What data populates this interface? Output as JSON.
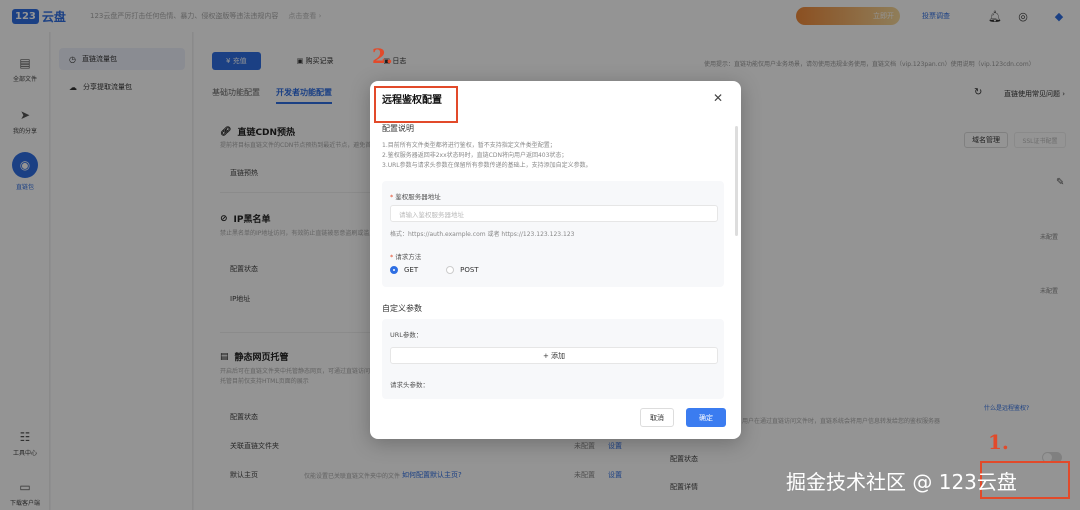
{
  "topbar": {
    "logo_badge": "123",
    "logo_text": "云盘",
    "notice": "123云盘严厉打击任何色情、暴力、侵权盗版等违法违规内容",
    "notice_more": "点击查看 ›",
    "promo_text": "",
    "promo_sub": "立即开",
    "link": "投票调查"
  },
  "rail": {
    "items": [
      {
        "label": "全部文件",
        "icon": "file-icon"
      },
      {
        "label": "我的分享",
        "icon": "share-icon"
      },
      {
        "label": "直链包",
        "icon": "link-icon"
      },
      {
        "label": "工具中心",
        "icon": "grid-icon"
      },
      {
        "label": "下载客户端",
        "icon": "monitor-icon"
      }
    ]
  },
  "sidenav": {
    "items": [
      {
        "label": "直链流量包"
      },
      {
        "label": "分享提取流量包"
      }
    ]
  },
  "main": {
    "tabs": [
      "充值",
      "购买记录",
      "日志"
    ],
    "subtabs": [
      "基础功能配置",
      "开发者功能配置"
    ],
    "right_notice": "使用提示：直链功能仅用户业务场景，请勿使用违规业务使用，直链文档（vip.123pan.cn）使用说明（vip.123cdn.com）",
    "help_link": "直链使用常见问题 ›",
    "cdn": {
      "title": "直链CDN预热",
      "desc": "提前将目标直链文件的CDN节点预热到最近节点，避免首次访问速度慢",
      "row_label": "直链预热"
    },
    "ip": {
      "title": "IP黑名单",
      "desc": "禁止黑名单的IP地址访问，有效防止直链被恶意盗刷或滥用。",
      "rows": [
        "配置状态",
        "IP地址"
      ]
    },
    "static": {
      "title": "静态网页托管",
      "desc1": "开启后可在直链文件夹中托管静态网页，可通过直链访问",
      "desc2": "托管目前仅支持HTML页面的展示",
      "rows": [
        "配置状态",
        "关联直链文件夹",
        "默认主页"
      ],
      "homepage_hint": "仅能设置已关联直链文件夹中的文件",
      "homepage_link": "如何配置默认主页?",
      "status_unconfigured": "未配置",
      "set_link": "设置"
    },
    "domain_btn": "域名管理",
    "ssl_btn": "SSL证书配置",
    "right_status_1": "未配置",
    "right_status_2": "未配置",
    "remote_link": "什么是远程鉴权?",
    "remote_desc": "用户在通过直链访问文件时，直链系统会将用户信息转发给您的鉴权服务器",
    "bottom_rows": [
      "配置状态",
      "配置详情"
    ]
  },
  "modal": {
    "title": "远程鉴权配置",
    "desc_title": "配置说明",
    "desc_lines": [
      "1.目前所有文件类型都将进行鉴权，暂不支持指定文件类型配置；",
      "2.鉴权服务器返回非2xx状态码时，直链CDN将向用户返回403状态；",
      "3.URL参数与请求头参数在保留所有参数传递的基础上，支持添加自定义参数。"
    ],
    "server_label": "鉴权服务器地址",
    "server_placeholder": "请输入鉴权服务器地址",
    "server_hint": "格式：https://auth.example.com 或者 https://123.123.123.123",
    "method_label": "请求方法",
    "methods": [
      "GET",
      "POST"
    ],
    "custom_title": "自定义参数",
    "url_params_label": "URL参数：",
    "add_label": "添加",
    "header_params_label": "请求头参数：",
    "cancel": "取消",
    "ok": "确定"
  },
  "annotations": {
    "step1": "1.",
    "step2": "2."
  },
  "watermark": "掘金技术社区 @ 123云盘",
  "colors": {
    "accent": "#2f6fe3",
    "annotation": "#e24a2a"
  }
}
